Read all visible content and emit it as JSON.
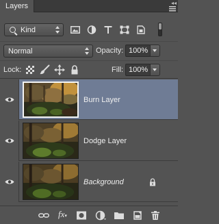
{
  "panel": {
    "tab_label": "Layers",
    "collapse_glyph": "◂◂",
    "menu_icon": "panel-menu-icon"
  },
  "filter": {
    "kind_label": "Kind",
    "icons": [
      "pixel-layer-filter-icon",
      "adjustment-layer-filter-icon",
      "type-layer-filter-icon",
      "shape-layer-filter-icon",
      "smart-object-filter-icon"
    ],
    "filter_toggle": "filter-on-off-toggle"
  },
  "blend": {
    "mode": "Normal",
    "opacity_label": "Opacity:",
    "opacity_value": "100%"
  },
  "lock": {
    "label": "Lock:",
    "icons": [
      "lock-transparent-pixels-icon",
      "lock-image-pixels-icon",
      "lock-position-icon",
      "lock-all-icon"
    ],
    "fill_label": "Fill:",
    "fill_value": "100%"
  },
  "layers": [
    {
      "name": "Burn Layer",
      "selected": true,
      "italic": false,
      "locked": false,
      "visible": true
    },
    {
      "name": "Dodge Layer",
      "selected": false,
      "italic": false,
      "locked": false,
      "visible": true
    },
    {
      "name": "Background",
      "selected": false,
      "italic": true,
      "locked": true,
      "visible": true
    }
  ],
  "bottom_bar": {
    "fx_label": "fx",
    "icons": [
      "link-layers-icon",
      "layer-style-fx-icon",
      "add-mask-icon",
      "new-fill-adjustment-icon",
      "new-group-folder-icon",
      "new-layer-icon",
      "delete-layer-trash-icon"
    ]
  },
  "colors": {
    "panel_bg": "#535353",
    "selection": "#6f7c95"
  }
}
